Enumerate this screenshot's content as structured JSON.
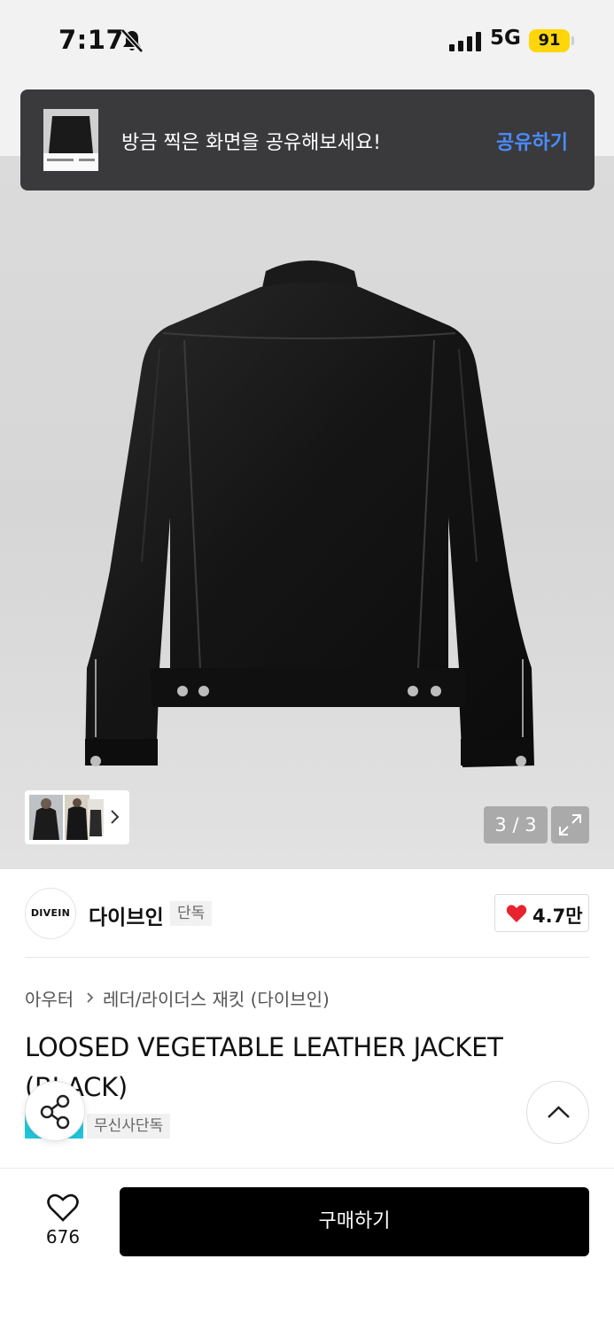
{
  "status_bar": {
    "time": "7:17",
    "network": "5G",
    "battery": "91",
    "icons": [
      "bell-slash-icon",
      "signal-icon",
      "battery-icon"
    ]
  },
  "share_toast": {
    "message": "방금 찍은 화면을 공유해보세요!",
    "action_label": "공유하기"
  },
  "gallery": {
    "counter": "3 / 3",
    "icons": [
      "chevron-right-icon",
      "expand-icon"
    ]
  },
  "brand": {
    "logo_text": "DIVEIN",
    "name": "다이브인",
    "badge": "단독",
    "like_count": "4.7만"
  },
  "breadcrumb": {
    "level1": "아우터",
    "level2": "레더/라이더스 재킷 (다이브인)"
  },
  "product": {
    "title": "LOOSED VEGETABLE LEATHER JACKET (BLACK)",
    "tag": "무신사단독"
  },
  "bottom_bar": {
    "wish_count": "676",
    "buy_label": "구매하기"
  },
  "colors": {
    "toast_bg": "#3a3a3c",
    "toast_action": "#4a8cff",
    "heart": "#e8232e",
    "battery": "#ffd60a",
    "buy_button": "#000000",
    "tag_accent": "#21c6dc"
  }
}
